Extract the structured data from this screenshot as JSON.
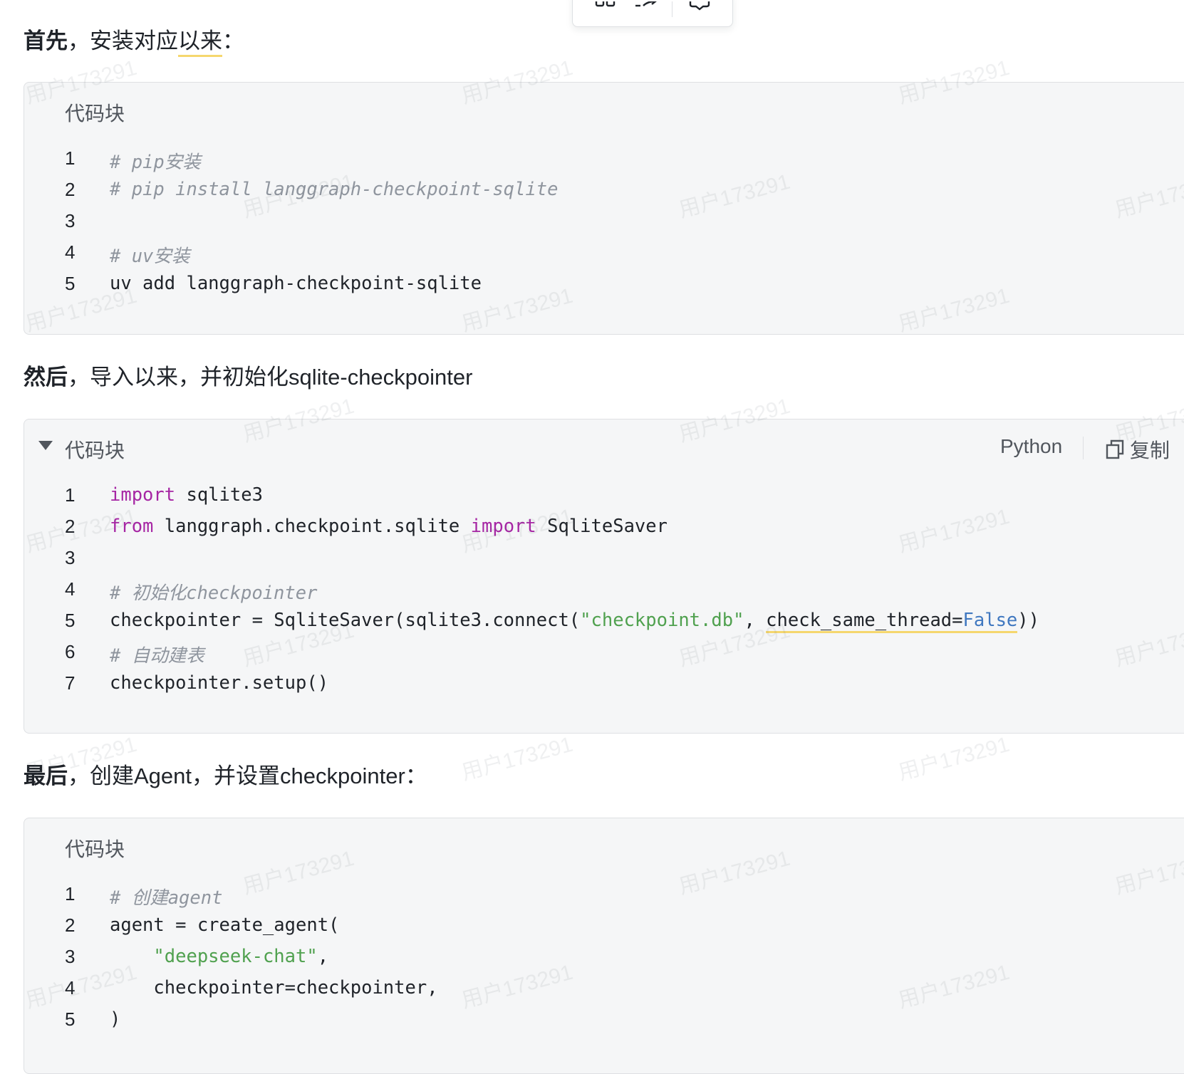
{
  "toolbar": {
    "items": [
      "grid-icon",
      "share-icon",
      "comment-icon"
    ]
  },
  "para1": {
    "bold": "首先",
    "text_a": "，安装对应",
    "text_underlined": "以来",
    "text_b": "："
  },
  "block1": {
    "title": "代码块",
    "lines": [
      {
        "n": "1",
        "html": "<span class=\"cm\"># pip安装</span>"
      },
      {
        "n": "2",
        "html": "<span class=\"cm\"># pip install langgraph-checkpoint-sqlite</span>"
      },
      {
        "n": "3",
        "html": ""
      },
      {
        "n": "4",
        "html": "<span class=\"cm\"># uv安装</span>"
      },
      {
        "n": "5",
        "html": "uv add langgraph-checkpoint-sqlite"
      }
    ]
  },
  "para2": {
    "bold": "然后",
    "text": "，导入以来，并初始化sqlite-checkpointer"
  },
  "block2": {
    "title": "代码块",
    "language": "Python",
    "copy_label": "复制",
    "lines": [
      {
        "n": "1",
        "html": "<span class=\"kw\">import</span> sqlite3"
      },
      {
        "n": "2",
        "html": "<span class=\"kw\">from</span> langgraph.checkpoint.sqlite <span class=\"kw\">import</span> SqliteSaver"
      },
      {
        "n": "3",
        "html": ""
      },
      {
        "n": "4",
        "html": "<span class=\"cm\"># 初始化checkpointer</span>"
      },
      {
        "n": "5",
        "html": "checkpointer = SqliteSaver(sqlite3.connect(<span class=\"st\">\"checkpoint.db\"</span>, <span class=\"warn\">check_same_thread=<span class=\"bl\">False</span></span>))"
      },
      {
        "n": "6",
        "html": "<span class=\"cm\"># 自动建表</span>"
      },
      {
        "n": "7",
        "html": "checkpointer.setup()"
      }
    ]
  },
  "para3": {
    "bold": "最后",
    "text": "，创建Agent，并设置checkpointer："
  },
  "block3": {
    "title": "代码块",
    "lines": [
      {
        "n": "1",
        "html": "<span class=\"cm\"># 创建agent</span>"
      },
      {
        "n": "2",
        "html": "agent = create_agent("
      },
      {
        "n": "3",
        "html": "    <span class=\"st\">\"deepseek-chat\"</span>,"
      },
      {
        "n": "4",
        "html": "    checkpointer=checkpointer,"
      },
      {
        "n": "5",
        "html": ")"
      }
    ]
  },
  "watermark_text": "用户173291"
}
